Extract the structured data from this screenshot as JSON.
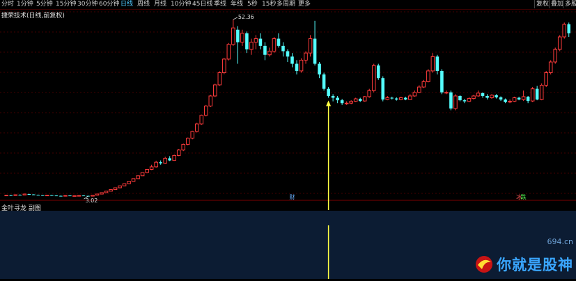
{
  "toolbar": {
    "periods": [
      "分时",
      "1分钟",
      "5分钟",
      "15分钟",
      "30分钟",
      "60分钟",
      "日线",
      "周线",
      "月线",
      "10分钟",
      "45日线",
      "季线",
      "年线",
      "5秒",
      "15秒",
      "多周期",
      "更多"
    ],
    "active_period": "日线",
    "right_tabs": [
      "复权",
      "叠加",
      "多股"
    ]
  },
  "main_title": "捷荣技术(日线,前复权)",
  "sub_title": "金叶寻龙 副图",
  "colors": {
    "up": "#ff3b3b",
    "down": "#54ffff",
    "grid": "#5a0000",
    "arrow": "#ffff44",
    "subpanel": "#0c1c33"
  },
  "chart_data": {
    "type": "candlestick",
    "high_label": "52.36",
    "low_label": "3.02",
    "markers": [
      {
        "index": 63,
        "text": "财"
      },
      {
        "index": 113,
        "text": "冰"
      },
      {
        "index": 114,
        "text": "跌"
      }
    ],
    "arrow_index": 71,
    "sub_arrow_index": 71,
    "candles": [
      [
        3.2,
        3.3,
        3.35,
        3.15
      ],
      [
        3.3,
        3.25,
        3.4,
        3.2
      ],
      [
        3.25,
        3.4,
        3.45,
        3.2
      ],
      [
        3.4,
        3.35,
        3.5,
        3.3
      ],
      [
        3.35,
        3.6,
        3.65,
        3.3
      ],
      [
        3.6,
        3.5,
        3.7,
        3.45
      ],
      [
        3.5,
        3.4,
        3.55,
        3.35
      ],
      [
        3.4,
        3.3,
        3.45,
        3.25
      ],
      [
        3.3,
        3.2,
        3.35,
        3.15
      ],
      [
        3.2,
        3.3,
        3.35,
        3.1
      ],
      [
        3.3,
        3.2,
        3.35,
        3.1
      ],
      [
        3.2,
        3.1,
        3.25,
        3.05
      ],
      [
        3.1,
        3.05,
        3.2,
        3.02
      ],
      [
        3.05,
        3.2,
        3.25,
        3.0
      ],
      [
        3.2,
        3.1,
        3.25,
        3.02
      ],
      [
        3.1,
        3.15,
        3.2,
        3.05
      ],
      [
        3.15,
        3.2,
        3.25,
        3.1
      ],
      [
        3.2,
        3.1,
        3.25,
        3.05
      ],
      [
        3.1,
        3.02,
        3.15,
        2.98
      ],
      [
        3.02,
        3.3,
        3.35,
        3.0
      ],
      [
        3.3,
        3.6,
        3.65,
        3.28
      ],
      [
        3.6,
        4.0,
        4.05,
        3.58
      ],
      [
        4.0,
        4.4,
        4.45,
        3.98
      ],
      [
        4.4,
        4.85,
        4.9,
        4.38
      ],
      [
        4.85,
        5.35,
        5.4,
        4.83
      ],
      [
        5.35,
        5.9,
        5.95,
        5.33
      ],
      [
        5.9,
        6.5,
        6.55,
        5.88
      ],
      [
        6.5,
        7.15,
        7.2,
        6.48
      ],
      [
        7.15,
        7.9,
        7.95,
        7.13
      ],
      [
        7.9,
        8.7,
        8.75,
        7.88
      ],
      [
        8.7,
        9.6,
        9.65,
        8.68
      ],
      [
        9.6,
        10.5,
        10.6,
        9.5
      ],
      [
        10.5,
        11.2,
        11.8,
        10.3
      ],
      [
        11.2,
        12.5,
        12.9,
        11.0
      ],
      [
        12.5,
        12.2,
        13.0,
        11.8
      ],
      [
        12.2,
        13.6,
        14.0,
        12.0
      ],
      [
        13.6,
        13.0,
        14.2,
        12.8
      ],
      [
        13.0,
        14.4,
        14.6,
        12.9
      ],
      [
        14.4,
        15.9,
        16.2,
        14.2
      ],
      [
        15.9,
        17.5,
        17.7,
        15.6
      ],
      [
        17.5,
        19.2,
        19.4,
        17.2
      ],
      [
        19.2,
        21.1,
        21.3,
        18.9
      ],
      [
        21.1,
        23.2,
        23.5,
        20.8
      ],
      [
        23.2,
        25.6,
        25.8,
        22.9
      ],
      [
        25.6,
        28.2,
        28.5,
        25.3
      ],
      [
        28.2,
        31.0,
        31.3,
        27.9
      ],
      [
        31.0,
        34.1,
        34.4,
        30.7
      ],
      [
        34.1,
        37.5,
        37.9,
        33.8
      ],
      [
        37.5,
        41.3,
        41.6,
        37.1
      ],
      [
        41.3,
        45.4,
        45.8,
        40.9
      ],
      [
        45.4,
        50.0,
        52.36,
        45.0
      ],
      [
        49.5,
        46.0,
        50.5,
        40.0
      ],
      [
        46.0,
        48.5,
        49.5,
        45.0
      ],
      [
        48.5,
        44.0,
        49.0,
        43.0
      ],
      [
        44.0,
        46.0,
        47.0,
        42.5
      ],
      [
        46.0,
        47.0,
        48.0,
        44.0
      ],
      [
        47.0,
        45.0,
        48.5,
        44.0
      ],
      [
        45.0,
        42.5,
        46.0,
        41.0
      ],
      [
        42.5,
        43.5,
        44.5,
        42.0
      ],
      [
        43.5,
        47.0,
        47.5,
        43.0
      ],
      [
        47.0,
        45.0,
        48.5,
        44.5
      ],
      [
        45.0,
        43.5,
        46.0,
        42.0
      ],
      [
        43.5,
        42.0,
        44.0,
        40.5
      ],
      [
        42.0,
        40.0,
        43.0,
        39.0
      ],
      [
        40.0,
        38.0,
        41.0,
        37.0
      ],
      [
        38.0,
        41.0,
        41.5,
        37.5
      ],
      [
        41.0,
        43.0,
        43.5,
        40.0
      ],
      [
        43.0,
        47.0,
        48.0,
        42.0
      ],
      [
        47.0,
        40.0,
        52.0,
        39.5
      ],
      [
        40.0,
        37.0,
        40.5,
        36.0
      ],
      [
        37.0,
        33.0,
        37.5,
        32.5
      ],
      [
        33.0,
        31.0,
        33.5,
        30.5
      ],
      [
        31.0,
        30.5,
        31.5,
        29.5
      ],
      [
        30.5,
        29.8,
        31.0,
        29.0
      ],
      [
        29.8,
        29.0,
        30.2,
        28.5
      ],
      [
        29.0,
        29.0,
        29.5,
        28.5
      ],
      [
        29.0,
        29.5,
        29.8,
        28.7
      ],
      [
        29.5,
        30.2,
        30.5,
        29.3
      ],
      [
        30.2,
        29.6,
        30.5,
        29.3
      ],
      [
        29.6,
        30.8,
        31.0,
        29.4
      ],
      [
        30.8,
        32.5,
        33.0,
        30.5
      ],
      [
        32.5,
        39.5,
        40.0,
        32.0
      ],
      [
        39.5,
        36.0,
        40.0,
        35.5
      ],
      [
        36.0,
        30.0,
        36.5,
        29.5
      ],
      [
        30.0,
        30.5,
        31.0,
        29.8
      ],
      [
        30.5,
        30.3,
        30.8,
        30.0
      ],
      [
        30.3,
        30.0,
        30.6,
        29.7
      ],
      [
        30.0,
        30.5,
        30.8,
        29.8
      ],
      [
        30.5,
        30.0,
        30.8,
        29.8
      ],
      [
        30.0,
        31.0,
        31.5,
        29.9
      ],
      [
        31.0,
        32.0,
        32.5,
        30.8
      ],
      [
        32.0,
        33.5,
        34.0,
        31.8
      ],
      [
        33.5,
        35.0,
        35.5,
        33.2
      ],
      [
        35.0,
        38.0,
        38.5,
        34.8
      ],
      [
        38.0,
        42.0,
        43.0,
        37.5
      ],
      [
        42.0,
        38.0,
        42.5,
        37.0
      ],
      [
        38.0,
        32.0,
        38.5,
        31.5
      ],
      [
        32.0,
        32.0,
        32.5,
        31.5
      ],
      [
        32.0,
        27.5,
        32.5,
        27.0
      ],
      [
        27.5,
        31.0,
        31.5,
        27.0
      ],
      [
        31.0,
        29.8,
        31.2,
        29.5
      ],
      [
        29.8,
        29.5,
        30.2,
        29.0
      ],
      [
        29.5,
        30.3,
        30.6,
        29.3
      ],
      [
        30.3,
        31.0,
        31.3,
        30.0
      ],
      [
        31.0,
        31.8,
        32.5,
        30.8
      ],
      [
        31.8,
        31.0,
        32.0,
        30.5
      ],
      [
        31.0,
        30.5,
        31.5,
        30.0
      ],
      [
        30.5,
        31.2,
        31.5,
        30.2
      ],
      [
        31.2,
        30.6,
        31.5,
        30.3
      ],
      [
        30.6,
        30.0,
        30.9,
        29.6
      ],
      [
        30.0,
        29.3,
        30.3,
        29.0
      ],
      [
        29.3,
        29.5,
        30.0,
        29.0
      ],
      [
        29.5,
        30.5,
        30.8,
        29.3
      ],
      [
        30.5,
        30.0,
        30.8,
        29.8
      ],
      [
        30.0,
        30.8,
        32.5,
        29.6
      ],
      [
        30.8,
        29.6,
        31.0,
        29.0
      ],
      [
        29.6,
        33.0,
        33.5,
        29.3
      ],
      [
        33.0,
        30.0,
        33.8,
        29.8
      ],
      [
        30.0,
        34.0,
        34.5,
        29.8
      ],
      [
        34.0,
        37.5,
        38.0,
        33.5
      ],
      [
        37.5,
        40.5,
        41.0,
        37.0
      ],
      [
        40.5,
        44.0,
        44.5,
        40.0
      ],
      [
        44.0,
        47.5,
        48.0,
        43.5
      ],
      [
        47.5,
        51.0,
        51.5,
        47.0
      ],
      [
        51.0,
        48.5,
        51.5,
        47.5
      ]
    ]
  }
}
